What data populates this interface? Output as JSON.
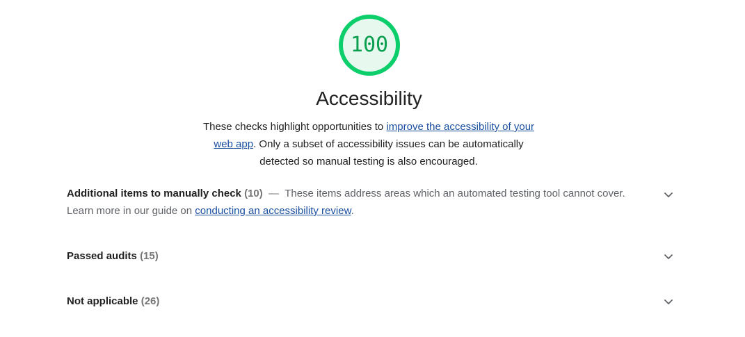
{
  "score": {
    "value": "100",
    "fraction": 1.0,
    "color": "#0cce6b",
    "fill_color": "#e7f8ef"
  },
  "category": {
    "title": "Accessibility",
    "desc_prefix": "These checks highlight opportunities to ",
    "desc_link": "improve the accessibility of your web app",
    "desc_suffix": ". Only a subset of accessibility issues can be automatically detected so manual testing is also encouraged."
  },
  "groups": {
    "manual": {
      "title": "Additional items to manually check",
      "count": "(10)",
      "separator": "—",
      "desc_prefix": "These items address areas which an automated testing tool cannot cover. Learn more in our guide on ",
      "desc_link": "conducting an accessibility review",
      "desc_suffix": ".",
      "icon": "chevron-down-icon"
    },
    "passed": {
      "title": "Passed audits",
      "count": "(15)",
      "icon": "chevron-down-icon"
    },
    "not_applicable": {
      "title": "Not applicable",
      "count": "(26)",
      "icon": "chevron-down-icon"
    }
  },
  "colors": {
    "link": "#1a4fa0",
    "text": "#212121",
    "muted": "#757575"
  }
}
